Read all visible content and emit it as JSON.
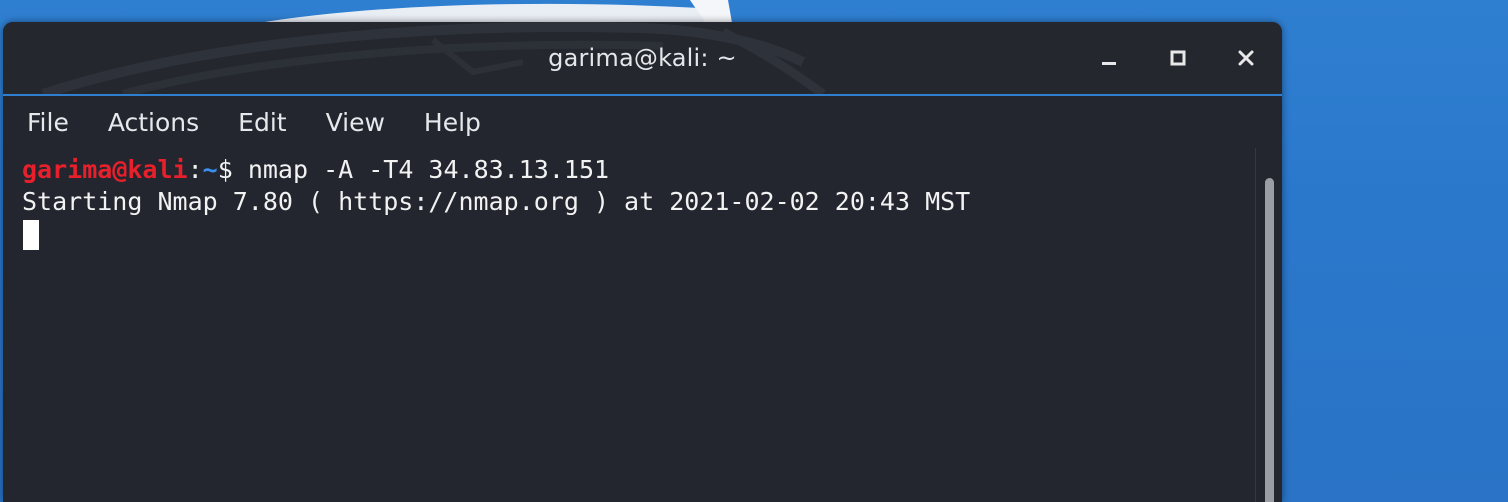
{
  "window": {
    "title": "garima@kali: ~"
  },
  "menu": {
    "items": [
      "File",
      "Actions",
      "Edit",
      "View",
      "Help"
    ]
  },
  "terminal": {
    "prompt_user": "garima@kali",
    "prompt_sep": ":",
    "prompt_path": "~",
    "prompt_symbol": "$ ",
    "command": "nmap -A -T4 34.83.13.151",
    "output_line": "Starting Nmap 7.80 ( https://nmap.org ) at 2021-02-02 20:43 MST"
  },
  "icons": {
    "minimize": "minimize-icon",
    "maximize": "maximize-icon",
    "close": "close-icon"
  },
  "colors": {
    "desktop_blue": "#2f7fd1",
    "terminal_bg": "#23262f",
    "prompt_user": "#e8202b",
    "prompt_path": "#3b8eea",
    "accent_line": "#2f7fd1"
  }
}
